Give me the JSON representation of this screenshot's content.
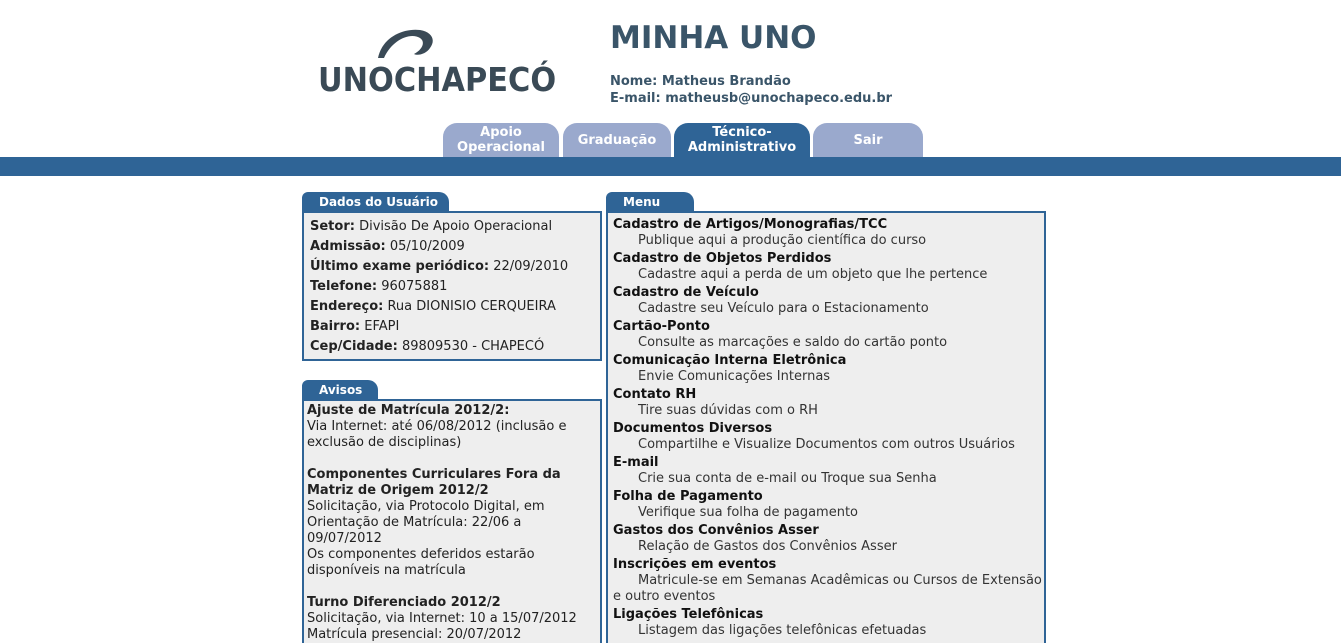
{
  "header": {
    "logo_text": "UNOCHAPECÓ",
    "app_title": "MINHA UNO",
    "user_name": "Nome: Matheus Brandão",
    "user_email": "E-mail: matheusb@unochapeco.edu.br"
  },
  "tabs": [
    {
      "line1": "Apoio",
      "line2": "Operacional"
    },
    {
      "line1": "Graduação",
      "line2": ""
    },
    {
      "line1": "Técnico-",
      "line2": "Administrativo"
    },
    {
      "line1": "Sair",
      "line2": ""
    }
  ],
  "user_data": {
    "title": "Dados do Usuário",
    "rows": [
      {
        "label": "Setor:",
        "value": " Divisão De Apoio Operacional"
      },
      {
        "label": "Admissão:",
        "value": " 05/10/2009"
      },
      {
        "label": "Último exame periódico:",
        "value": " 22/09/2010"
      },
      {
        "label": "Telefone:",
        "value": " 96075881"
      },
      {
        "label": "Endereço:",
        "value": " Rua DIONISIO CERQUEIRA"
      },
      {
        "label": "Bairro:",
        "value": " EFAPI"
      },
      {
        "label": "Cep/Cidade:",
        "value": " 89809530 - CHAPECÓ"
      }
    ]
  },
  "avisos": {
    "title": "Avisos",
    "items": [
      {
        "title": "Ajuste de Matrícula 2012/2:",
        "lines": [
          "Via Internet: até 06/08/2012 (inclusão e exclusão de disciplinas)"
        ]
      },
      {
        "title": "Componentes Curriculares Fora da Matriz de Origem 2012/2",
        "lines": [
          "Solicitação, via Protocolo Digital, em Orientação de Matrícula: 22/06 a 09/07/2012",
          "Os componentes deferidos estarão disponíveis na matrícula"
        ]
      },
      {
        "title": "Turno Diferenciado 2012/2",
        "lines": [
          "Solicitação, via Internet: 10 a 15/07/2012",
          "Matrícula presencial: 20/07/2012"
        ]
      }
    ]
  },
  "menu": {
    "title": "Menu",
    "items": [
      {
        "title": "Cadastro de Artigos/Monografias/TCC",
        "desc": "Publique aqui a produção científica do curso"
      },
      {
        "title": "Cadastro de Objetos Perdidos",
        "desc": "Cadastre aqui a perda de um objeto que lhe pertence"
      },
      {
        "title": "Cadastro de Veículo",
        "desc": "Cadastre seu Veículo para o Estacionamento"
      },
      {
        "title": "Cartão-Ponto",
        "desc": "Consulte as marcações e saldo do cartão ponto"
      },
      {
        "title": "Comunicação Interna Eletrônica",
        "desc": "Envie Comunicações Internas"
      },
      {
        "title": "Contato RH",
        "desc": "Tire suas dúvidas com o RH"
      },
      {
        "title": "Documentos Diversos",
        "desc": "Compartilhe e Visualize Documentos com outros Usuários"
      },
      {
        "title": "E-mail",
        "desc": "Crie sua conta de e-mail ou Troque sua Senha"
      },
      {
        "title": "Folha de Pagamento",
        "desc": "Verifique sua folha de pagamento"
      },
      {
        "title": "Gastos dos Convênios Asser",
        "desc": "Relação de Gastos dos Convênios Asser"
      },
      {
        "title": "Inscrições em eventos",
        "desc": "Matricule-se em Semanas Acadêmicas ou Cursos de Extensão e outro eventos"
      },
      {
        "title": "Ligações Telefônicas",
        "desc": "Listagem das ligações telefônicas efetuadas"
      }
    ]
  },
  "colors": {
    "brand_blue": "#2f6496",
    "tab_inactive": "#9aa9cd",
    "panel_bg": "#eeeeee",
    "title_text": "#3a5569"
  }
}
